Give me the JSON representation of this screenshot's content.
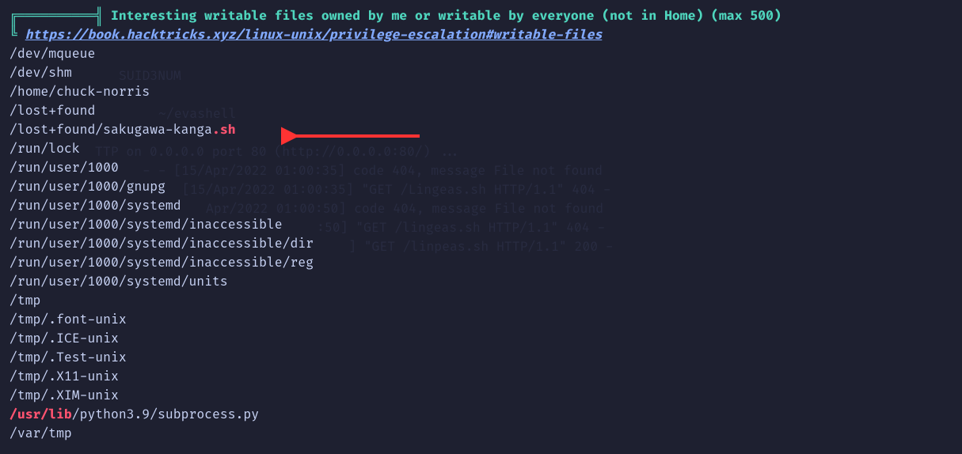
{
  "header": {
    "bracket_top": "╔══════════╣",
    "title": " Interesting writable files owned by me or writable by everyone (not in Home) (max 500)",
    "bracket_bottom": "╚ ",
    "url": "https://book.hacktricks.xyz/linux-unix/privilege-escalation#writable-files"
  },
  "files": [
    {
      "path": "/dev/mqueue"
    },
    {
      "path": "/dev/shm"
    },
    {
      "path": "/home/chuck-norris"
    },
    {
      "path": "/lost+found"
    },
    {
      "path_prefix": "/lost+found/sakugawa-kanga",
      "path_suffix": ".sh",
      "highlighted_suffix": true
    },
    {
      "path": "/run/lock"
    },
    {
      "path": "/run/user/1000"
    },
    {
      "path": "/run/user/1000/gnupg"
    },
    {
      "path": "/run/user/1000/systemd"
    },
    {
      "path": "/run/user/1000/systemd/inaccessible"
    },
    {
      "path": "/run/user/1000/systemd/inaccessible/dir"
    },
    {
      "path": "/run/user/1000/systemd/inaccessible/reg"
    },
    {
      "path": "/run/user/1000/systemd/units"
    },
    {
      "path": "/tmp"
    },
    {
      "path": "/tmp/.font-unix"
    },
    {
      "path": "/tmp/.ICE-unix"
    },
    {
      "path": "/tmp/.Test-unix"
    },
    {
      "path": "/tmp/.X11-unix"
    },
    {
      "path": "/tmp/.XIM-unix"
    },
    {
      "path_prefix_hl": "/usr/lib",
      "path_suffix_plain": "/python3.9/subprocess.py",
      "highlighted_prefix": true
    },
    {
      "path": "/var/tmp"
    }
  ],
  "ghost": {
    "line1": "TTP on 0.0.0.0 port 80 (http://0.0.0.0:80/) ...",
    "line2": "- - [15/Apr/2022 01:00:35] code 404, message File not found",
    "line3": "[15/Apr/2022 01:00:35] \"GET /Lingeas.sh HTTP/1.1\" 404 -",
    "line4": "Apr/2022 01:00:50] code 404, message File not found",
    "line5": ":50] \"GET /lingeas.sh HTTP/1.1\" 404 -",
    "line6": "] \"GET /linpeas.sh HTTP/1.1\" 200 -",
    "suid": "SUID3NUM",
    "evashell": "~/evashell"
  }
}
